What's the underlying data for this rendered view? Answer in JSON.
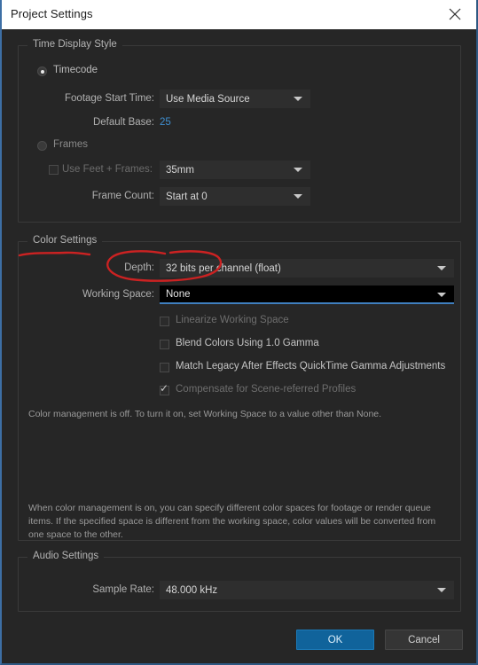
{
  "window": {
    "title": "Project Settings",
    "close_icon": "close-icon",
    "border_color": "#3d6fa5"
  },
  "sections": {
    "time_display": {
      "label": "Time Display Style",
      "timecode": {
        "radio_label": "Timecode",
        "selected": true,
        "footage_start_time": {
          "label": "Footage Start Time:",
          "value": "Use Media Source"
        },
        "default_base": {
          "label": "Default Base:",
          "value": "25",
          "value_color": "#3f8fd0"
        }
      },
      "frames": {
        "radio_label": "Frames",
        "selected": false,
        "use_feet_frames": {
          "label": "Use Feet + Frames:",
          "checked": false,
          "value": "35mm"
        },
        "frame_count": {
          "label": "Frame Count:",
          "value": "Start at 0"
        }
      }
    },
    "color_settings": {
      "label": "Color Settings",
      "depth": {
        "label": "Depth:",
        "value": "32 bits per channel (float)"
      },
      "working_space": {
        "label": "Working Space:",
        "value": "None",
        "focused": true
      },
      "checkboxes": [
        {
          "label": "Linearize Working Space",
          "checked": false,
          "disabled": true
        },
        {
          "label": "Blend Colors Using 1.0 Gamma",
          "checked": false,
          "disabled": false
        },
        {
          "label": "Match Legacy After Effects QuickTime Gamma Adjustments",
          "checked": false,
          "disabled": false
        },
        {
          "label": "Compensate for Scene-referred Profiles",
          "checked": true,
          "disabled": true
        }
      ],
      "status_note": "Color management is off. To turn it on, set Working Space to a value other than None.",
      "help_note": "When color management is on, you can specify different color spaces for footage or render queue items. If the specified space is different from the working space, color values will be converted from one space to the other."
    },
    "audio_settings": {
      "label": "Audio Settings",
      "sample_rate": {
        "label": "Sample Rate:",
        "value": "48.000 kHz"
      }
    }
  },
  "footer": {
    "ok_label": "OK",
    "cancel_label": "Cancel",
    "ok_color": "#10639b"
  },
  "annotations": {
    "color": "#cc2222",
    "underline_target": "Color Settings",
    "ellipse_target": "Depth:"
  }
}
